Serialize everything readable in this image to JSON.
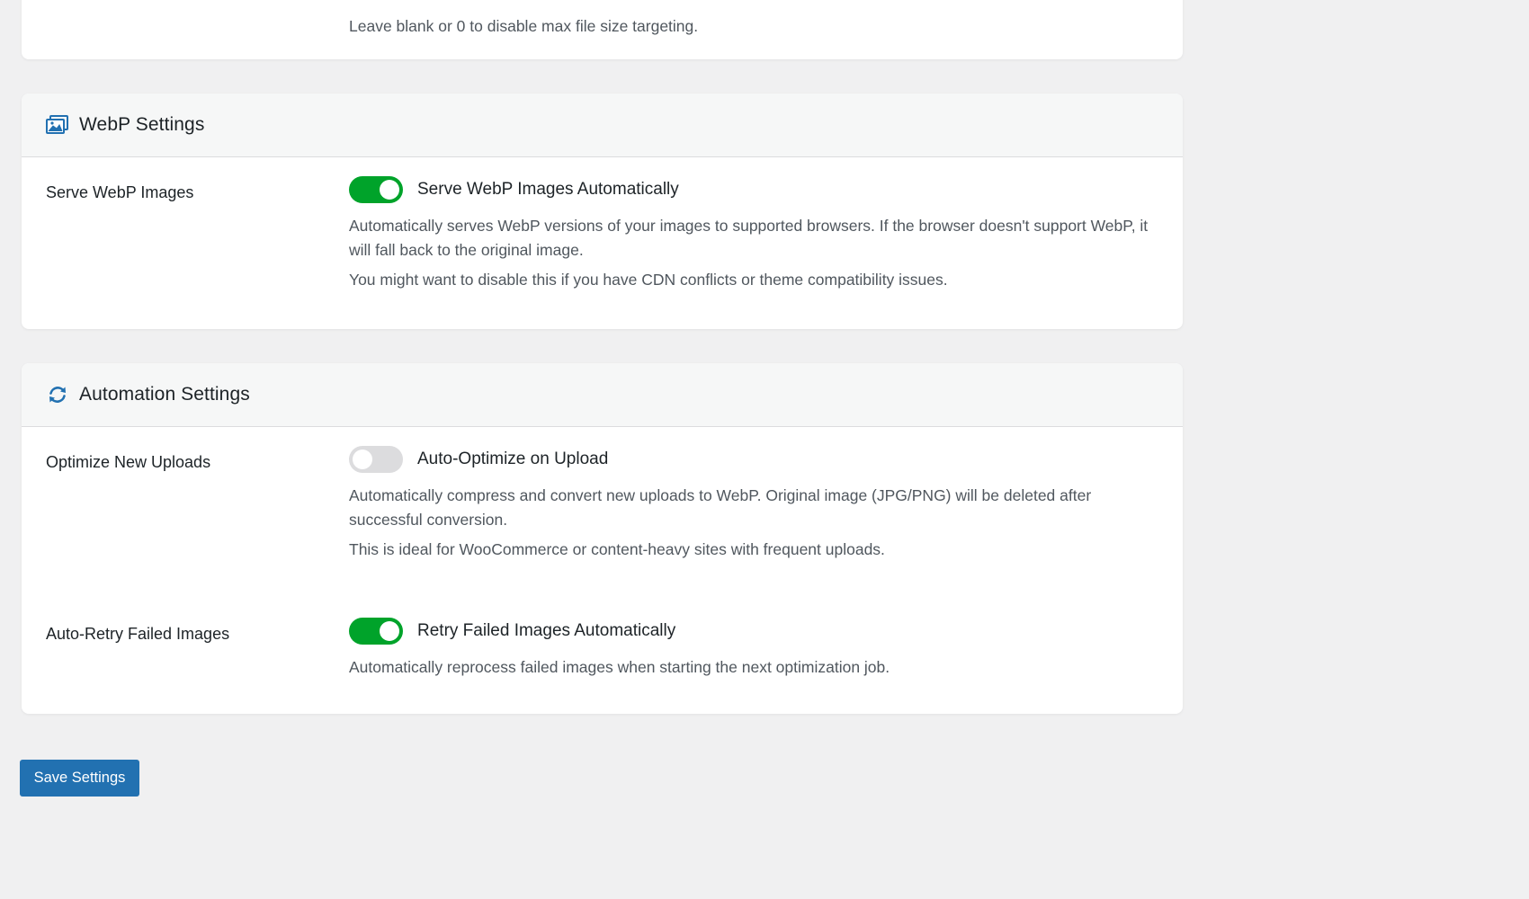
{
  "top_card": {
    "description": "Leave blank or 0 to disable max file size targeting."
  },
  "webp_settings": {
    "icon": "image-icon",
    "title": "WebP Settings",
    "rows": [
      {
        "label": "Serve WebP Images",
        "toggle_state": true,
        "toggle_label": "Serve WebP Images Automatically",
        "descriptions": [
          "Automatically serves WebP versions of your images to supported browsers. If the browser doesn't support WebP, it will fall back to the original image.",
          "You might want to disable this if you have CDN conflicts or theme compatibility issues."
        ]
      }
    ]
  },
  "automation_settings": {
    "icon": "sync-icon",
    "title": "Automation Settings",
    "rows": [
      {
        "label": "Optimize New Uploads",
        "toggle_state": false,
        "toggle_label": "Auto-Optimize on Upload",
        "descriptions": [
          "Automatically compress and convert new uploads to WebP. Original image (JPG/PNG) will be deleted after successful conversion.",
          "This is ideal for WooCommerce or content-heavy sites with frequent uploads."
        ]
      },
      {
        "label": "Auto-Retry Failed Images",
        "toggle_state": true,
        "toggle_label": "Retry Failed Images Automatically",
        "descriptions": [
          "Automatically reprocess failed images when starting the next optimization job."
        ]
      }
    ]
  },
  "save_button": {
    "label": "Save Settings"
  },
  "colors": {
    "background": "#f0f0f1",
    "toggle_on": "#00a32a",
    "toggle_off": "#dcdcde",
    "primary_button": "#2271b1",
    "icon_blue": "#2271b1"
  }
}
